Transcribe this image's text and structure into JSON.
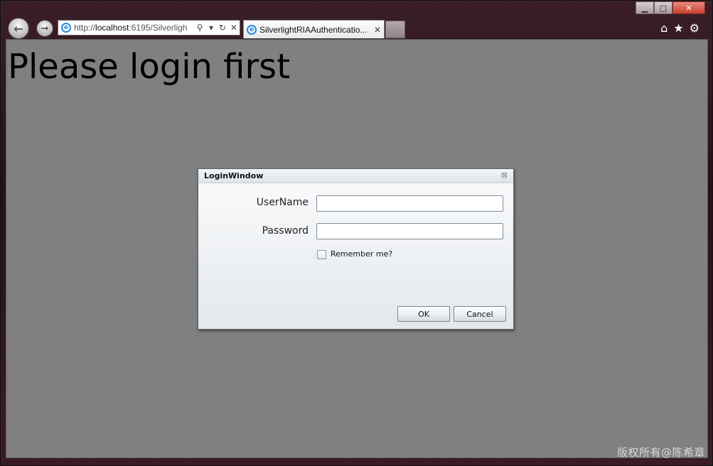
{
  "browser": {
    "address_url_plain": "http://",
    "address_url_host": "localhost",
    "address_url_rest": ":6195/Silverligh",
    "tab_title": "SilverlightRIAAuthenticatio...",
    "tab_icon": "ie-icon",
    "caption": {
      "minimize": "▁",
      "maximize": "□",
      "close": "✕"
    },
    "nav": {
      "back": "←",
      "forward": "→"
    },
    "address_icons": {
      "search": "⚲",
      "dropdown": "▾",
      "refresh": "↻",
      "stop": "✕"
    },
    "toolbar_icons": {
      "home": "⌂",
      "favorites": "★",
      "tools": "⚙"
    }
  },
  "page": {
    "heading": "Please login first"
  },
  "login_window": {
    "title": "LoginWindow",
    "close_icon": "⊠",
    "username_label": "UserName",
    "username_value": "",
    "password_label": "Password",
    "password_value": "",
    "remember_label": "Remember me?",
    "remember_checked": false,
    "ok_label": "OK",
    "cancel_label": "Cancel"
  },
  "watermark": "版权所有@陈希章",
  "colors": {
    "page_background": "#808080",
    "chrome_background": "#2a0f18",
    "close_button": "#c8412b"
  }
}
